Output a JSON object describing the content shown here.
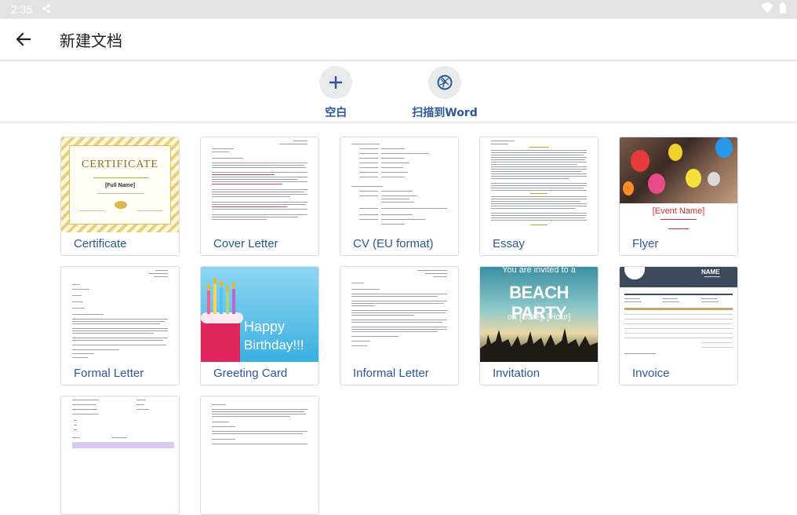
{
  "status": {
    "time": "2:35"
  },
  "header": {
    "title": "新建文档"
  },
  "actions": [
    {
      "label": "空白",
      "icon": "plus-icon"
    },
    {
      "label": "扫描到Word",
      "icon": "camera-shutter-icon"
    }
  ],
  "templates": [
    {
      "label": "Certificate",
      "thumb": {
        "title": "CERTIFICATE",
        "name": "[Full Name]"
      }
    },
    {
      "label": "Cover Letter"
    },
    {
      "label": "CV (EU format)"
    },
    {
      "label": "Essay"
    },
    {
      "label": "Flyer",
      "thumb": {
        "event": "[Event Name]"
      }
    },
    {
      "label": "Formal Letter"
    },
    {
      "label": "Greeting Card",
      "thumb": {
        "line1": "Happy",
        "line2": "Birthday!!!"
      }
    },
    {
      "label": "Informal Letter"
    },
    {
      "label": "Invitation",
      "thumb": {
        "top": "You are invited to a",
        "main": "BEACH PARTY",
        "sub": "on [Date], [Hour]"
      }
    },
    {
      "label": "Invoice",
      "thumb": {
        "name": "NAME"
      }
    },
    {
      "label": ""
    },
    {
      "label": ""
    }
  ],
  "colors": {
    "accent": "#2b579a",
    "cert_gold": "#c9a227",
    "greeting_bg": "#5fc0e6"
  }
}
